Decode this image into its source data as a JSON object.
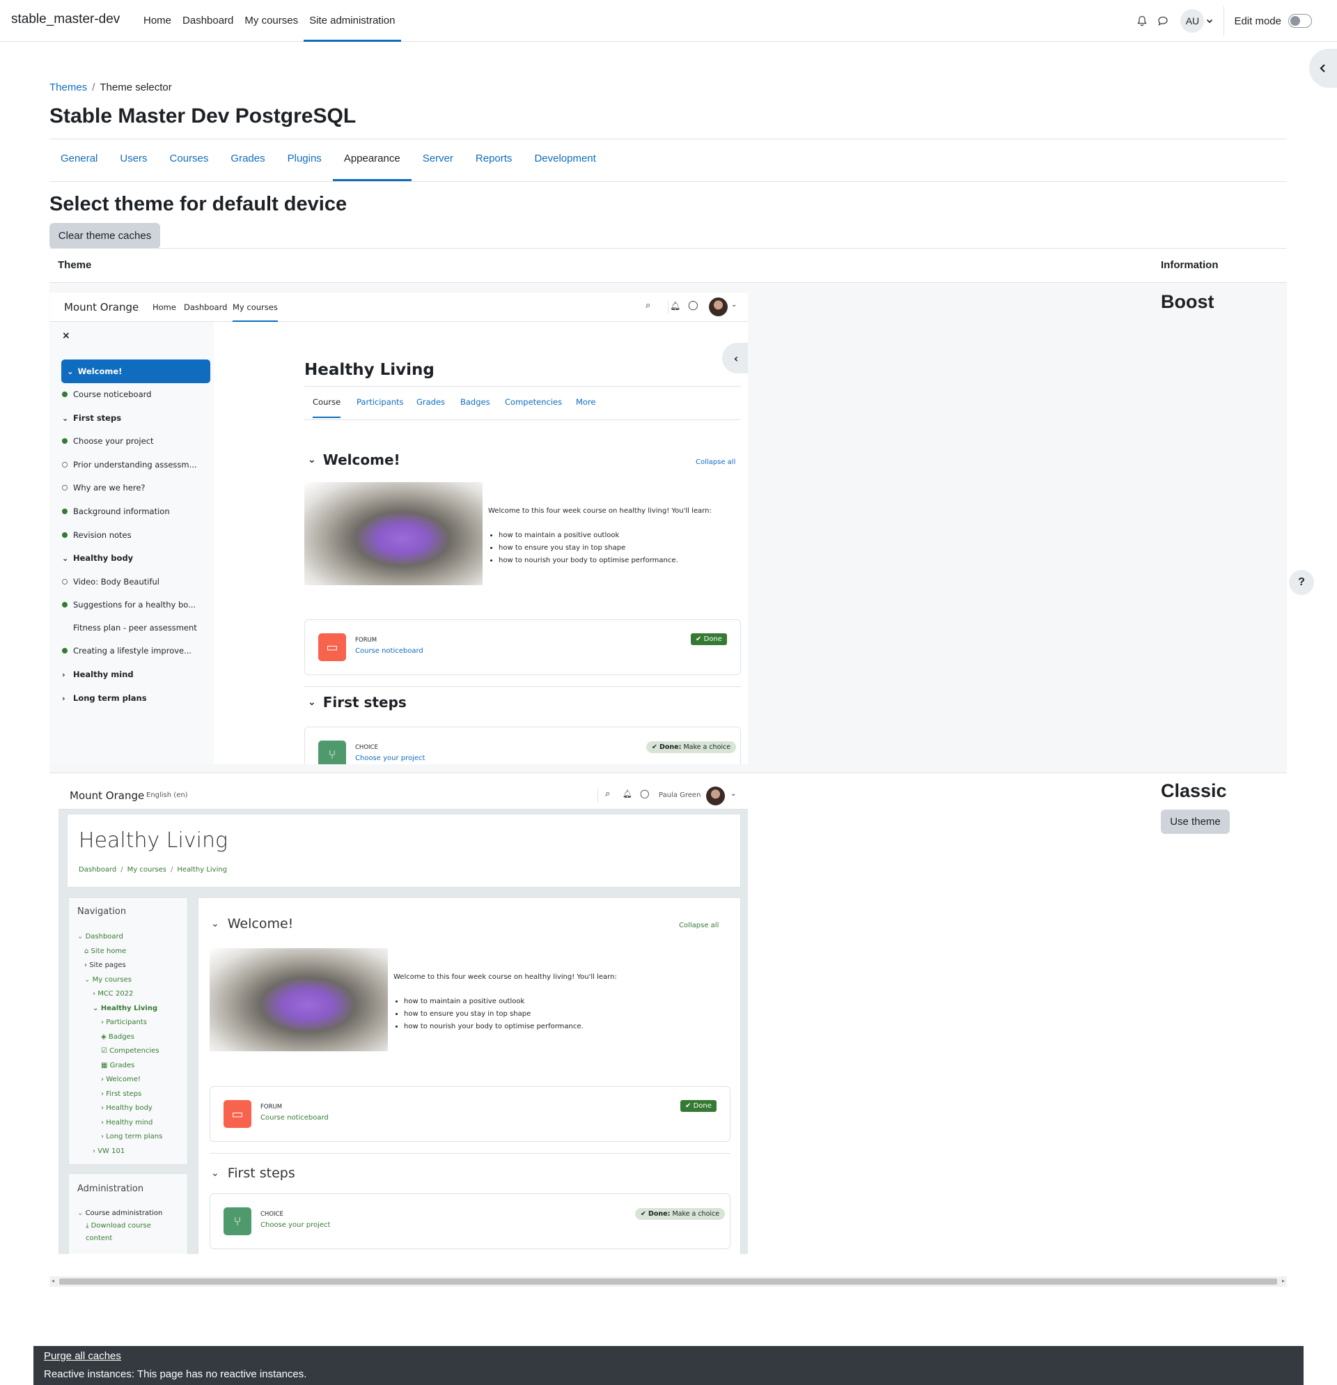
{
  "site_name": "stable_master-dev",
  "primary_nav": [
    "Home",
    "Dashboard",
    "My courses",
    "Site administration"
  ],
  "user": {
    "initials": "AU",
    "edit_mode_label": "Edit mode"
  },
  "breadcrumb": [
    "Themes",
    "Theme selector"
  ],
  "page_title": "Stable Master Dev PostgreSQL",
  "admin_tabs": [
    "General",
    "Users",
    "Courses",
    "Grades",
    "Plugins",
    "Appearance",
    "Server",
    "Reports",
    "Development"
  ],
  "section_heading": "Select theme for default device",
  "clear_caches_label": "Clear theme caches",
  "table_headers": {
    "theme": "Theme",
    "information": "Information"
  },
  "themes": [
    {
      "name": "Boost"
    },
    {
      "name": "Classic",
      "button": "Use theme"
    }
  ],
  "boost_preview": {
    "site": "Mount Orange",
    "nav": [
      "Home",
      "Dashboard",
      "My courses"
    ],
    "sidebar": [
      "Welcome!",
      "Course noticeboard",
      "First steps",
      "Choose your project",
      "Prior understanding assessm...",
      "Why are we here?",
      "Background information",
      "Revision notes",
      "Healthy body",
      "Video: Body Beautiful",
      "Suggestions for a healthy bo...",
      "Fitness plan - peer assessment",
      "Creating a lifestyle improve...",
      "Healthy mind",
      "Long term plans"
    ],
    "course_title": "Healthy Living",
    "course_tabs": [
      "Course",
      "Participants",
      "Grades",
      "Badges",
      "Competencies",
      "More"
    ],
    "section1": "Welcome!",
    "collapse_all": "Collapse all",
    "intro": "Welcome to this four week course on healthy living! You'll learn:",
    "bullets": [
      "how to maintain a positive outlook",
      "how to ensure you stay in top shape",
      "how to nourish your body to optimise performance."
    ],
    "forum_type": "FORUM",
    "forum_name": "Course noticeboard",
    "done": "Done",
    "section2": "First steps",
    "choice_type": "CHOICE",
    "choice_name": "Choose your project",
    "done_choice_bold": "Done:",
    "done_choice_text": "Make a choice"
  },
  "classic_preview": {
    "site": "Mount Orange",
    "lang": "English (en)",
    "user": "Paula Green",
    "course_title": "Healthy Living",
    "crumbs": [
      "Dashboard",
      "My courses",
      "Healthy Living"
    ],
    "nav_title": "Navigation",
    "nav_items": [
      "Dashboard",
      "Site home",
      "Site pages",
      "My courses",
      "MCC 2022",
      "Healthy Living",
      "Participants",
      "Badges",
      "Competencies",
      "Grades",
      "Welcome!",
      "First steps",
      "Healthy body",
      "Healthy mind",
      "Long term plans",
      "VW 101"
    ],
    "admin_title": "Administration",
    "admin_items": [
      "Course administration",
      "Download course",
      "content"
    ],
    "section1": "Welcome!",
    "collapse_all": "Collapse all",
    "intro": "Welcome to this four week course on healthy living! You'll learn:",
    "bullets": [
      "how to maintain a positive outlook",
      "how to ensure you stay in top shape",
      "how to nourish your body to optimise performance."
    ],
    "forum_type": "FORUM",
    "forum_name": "Course noticeboard",
    "done": "Done",
    "section2": "First steps",
    "choice_type": "CHOICE",
    "choice_name": "Choose your project",
    "done_choice_bold": "Done:",
    "done_choice_text": "Make a choice"
  },
  "footer": {
    "purge": "Purge all caches",
    "reactive": "Reactive instances: This page has no reactive instances."
  },
  "colors": {
    "link": "#0f6cbf",
    "classic_green": "#357a32",
    "forum": "#f7634d",
    "choice": "#399be2"
  }
}
